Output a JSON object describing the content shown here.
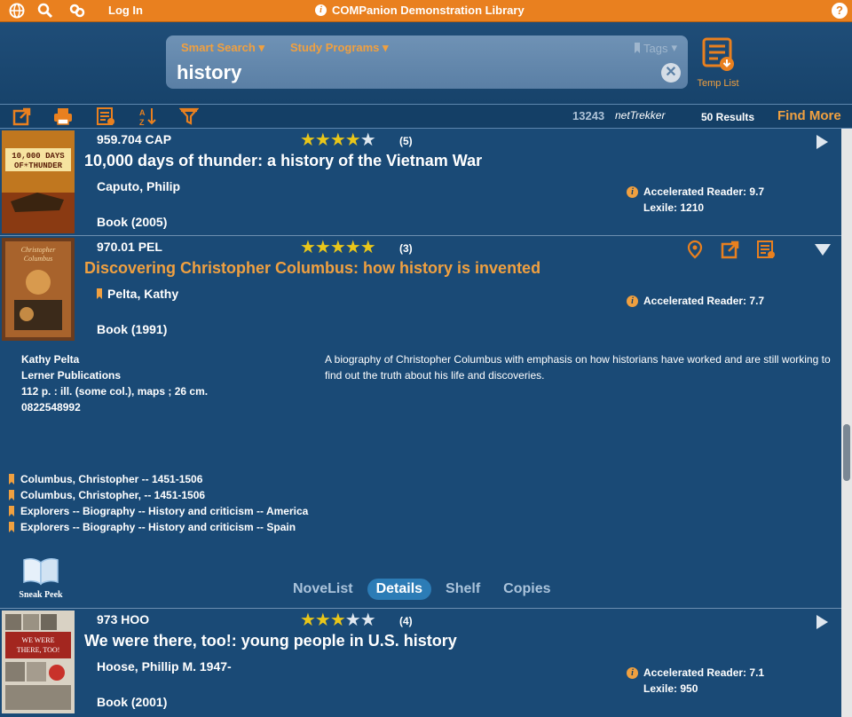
{
  "topbar": {
    "login": "Log In",
    "title": "COMPanion Demonstration Library",
    "help": "?"
  },
  "search": {
    "tab_smart": "Smart Search",
    "tab_study": "Study Programs",
    "tags": "Tags",
    "value": "history",
    "templist": "Temp List"
  },
  "toolbar": {
    "count": "13243",
    "net_logo": "netTrekker",
    "results": "50 Results",
    "find_more": "Find More"
  },
  "colors": {
    "orange": "#e9801f",
    "accent": "#f0a040",
    "background": "#143f66",
    "star": "#e9c61a"
  },
  "items": [
    {
      "callno": "959.704 CAP",
      "rating": 4,
      "votes": "(5)",
      "title": "10,000 days of thunder: a history of the Vietnam War",
      "author": "Caputo, Philip",
      "format": "Book (2005)",
      "ar": "Accelerated Reader: 9.7",
      "lexile": "Lexile: 1210",
      "cover_text": "10,000 DAYS OF THUNDER"
    },
    {
      "callno": "970.01 PEL",
      "rating": 5,
      "votes": "(3)",
      "title": "Discovering Christopher Columbus: how history is invented",
      "author": "Pelta, Kathy",
      "format": "Book (1991)",
      "ar": "Accelerated Reader: 7.7",
      "cover_text": "Christopher Columbus",
      "details": {
        "pub_lines": [
          "Kathy Pelta",
          "Lerner Publications",
          "112 p. : ill. (some col.), maps ; 26 cm.",
          "0822548992"
        ],
        "summary": "A biography of Christopher Columbus with emphasis on how historians have worked and are still working to find out the truth about his life and discoveries.",
        "subjects": [
          "Columbus, Christopher -- 1451-1506",
          "Columbus, Christopher, -- 1451-1506",
          "Explorers -- Biography -- History and criticism -- America",
          "Explorers -- Biography -- History and criticism -- Spain"
        ],
        "sneak_peek": "Sneak Peek",
        "tabs": [
          "NoveList",
          "Details",
          "Shelf",
          "Copies"
        ],
        "active_tab": "Details"
      }
    },
    {
      "callno": "973 HOO",
      "rating": 3,
      "votes": "(4)",
      "title": "We were there, too!: young people in U.S. history",
      "author": "Hoose, Phillip M. 1947-",
      "format": "Book (2001)",
      "ar": "Accelerated Reader: 7.1",
      "lexile": "Lexile: 950",
      "cover_text": "WE WERE THERE, TOO!"
    }
  ]
}
